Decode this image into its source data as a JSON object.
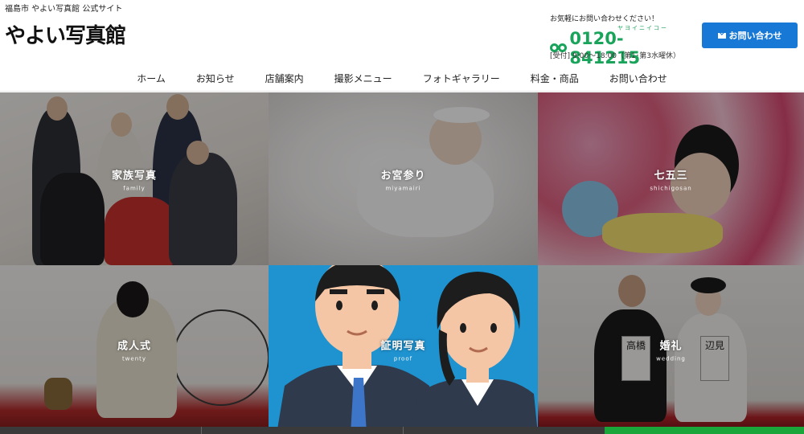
{
  "header": {
    "tagline": "福島市 やよい写真館 公式サイト",
    "logo": "やよい写真館",
    "contact_lead": "お気軽にお問い合わせください！",
    "tel_kana": "ヤヨイニイコー",
    "tel_number": "0120-841215",
    "hours": "[受付] 9:00〜18:00（第1･第3水曜休）",
    "contact_button": "お問い合わせ",
    "accent_color": "#1aa35a",
    "button_color": "#1778d6"
  },
  "nav": {
    "items": [
      "ホーム",
      "お知らせ",
      "店舗案内",
      "撮影メニュー",
      "フォトギャラリー",
      "料金・商品",
      "お問い合わせ"
    ]
  },
  "tiles": [
    {
      "jp": "家族写真",
      "en": "family"
    },
    {
      "jp": "お宮参り",
      "en": "miyamairi"
    },
    {
      "jp": "七五三",
      "en": "shichigosan"
    },
    {
      "jp": "成人式",
      "en": "twenty"
    },
    {
      "jp": "証明写真",
      "en": "proof"
    },
    {
      "jp": "婚礼",
      "en": "wedding"
    }
  ],
  "wedding_signs": [
    "高橋",
    "辺見"
  ]
}
